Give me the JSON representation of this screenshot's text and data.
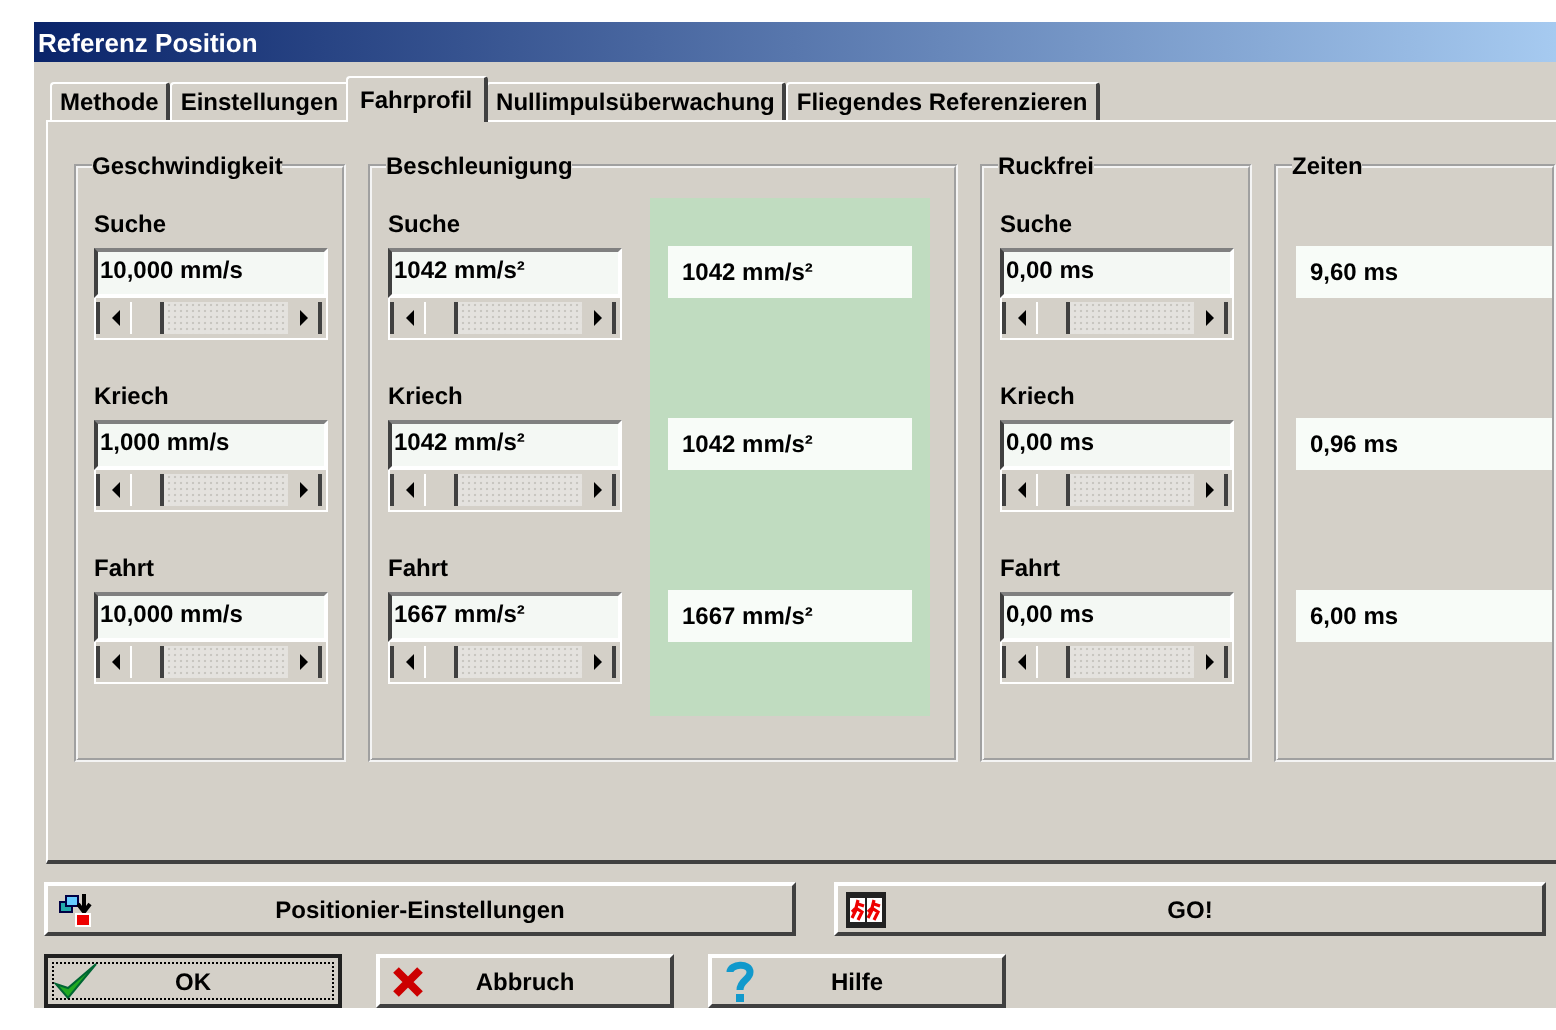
{
  "window": {
    "title": "Referenz Position"
  },
  "tabs": [
    {
      "label": "Methode",
      "selected": false
    },
    {
      "label": "Einstellungen",
      "selected": false
    },
    {
      "label": "Fahrprofil",
      "selected": true
    },
    {
      "label": "Nullimpulsüberwachung",
      "selected": false
    },
    {
      "label": "Fliegendes Referenzieren",
      "selected": false
    }
  ],
  "groups": [
    {
      "kind": "input",
      "title": "Geschwindigkeit",
      "rows": [
        {
          "label": "Suche",
          "value": "10,000 mm/s",
          "level": 0
        },
        {
          "label": "Kriech",
          "value": "1,000 mm/s",
          "level": 0
        },
        {
          "label": "Fahrt",
          "value": "10,000 mm/s",
          "level": 0
        }
      ]
    },
    {
      "kind": "input_result",
      "title": "Beschleunigung",
      "rows": [
        {
          "label": "Suche",
          "value": "1042 mm/s²",
          "level": 0,
          "result": "1042 mm/s²"
        },
        {
          "label": "Kriech",
          "value": "1042 mm/s²",
          "level": 0,
          "result": "1042 mm/s²"
        },
        {
          "label": "Fahrt",
          "value": "1667 mm/s²",
          "level": 0,
          "result": "1667 mm/s²"
        }
      ]
    },
    {
      "kind": "input",
      "title": "Ruckfrei",
      "rows": [
        {
          "label": "Suche",
          "value": "0,00 ms",
          "level": 0
        },
        {
          "label": "Kriech",
          "value": "0,00 ms",
          "level": 0
        },
        {
          "label": "Fahrt",
          "value": "0,00 ms",
          "level": 0
        }
      ]
    },
    {
      "kind": "output",
      "title": "Zeiten",
      "rows": [
        {
          "result": "9,60 ms"
        },
        {
          "result": "0,96 ms"
        },
        {
          "result": "6,00 ms"
        }
      ]
    }
  ],
  "wide_buttons": [
    {
      "kind": "settings",
      "label": "Positionier-Einstellungen",
      "focused": false
    },
    {
      "kind": "go",
      "label": "GO!",
      "focused": false
    }
  ],
  "buttons": [
    {
      "kind": "ok",
      "label": "OK",
      "focused": true
    },
    {
      "kind": "cancel",
      "label": "Abbruch",
      "focused": false
    },
    {
      "kind": "help",
      "label": "Hilfe",
      "focused": false
    }
  ]
}
